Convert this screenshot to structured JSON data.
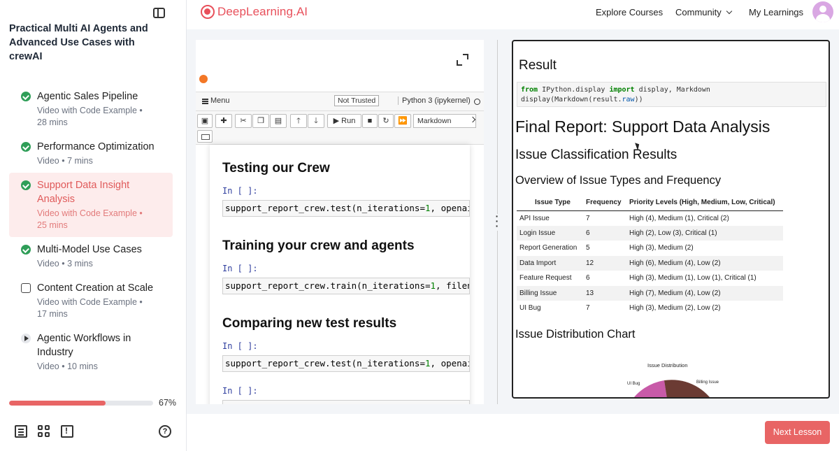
{
  "sidebar": {
    "course_title": "Practical Multi AI Agents and Advanced Use Cases with crewAI",
    "lessons": [
      {
        "title": "Agentic Sales Pipeline",
        "meta1": "Video with Code Example •",
        "meta2": "28 mins",
        "status": "done"
      },
      {
        "title": "Performance Optimization",
        "meta1": "Video • 7 mins",
        "meta2": "",
        "status": "done"
      },
      {
        "title": "Support Data Insight Analysis",
        "meta1": "Video with Code Example •",
        "meta2": "25 mins",
        "status": "done-active"
      },
      {
        "title": "Multi-Model Use Cases",
        "meta1": "Video • 3 mins",
        "meta2": "",
        "status": "done"
      },
      {
        "title": "Content Creation at Scale",
        "meta1": "Video with Code Example •",
        "meta2": "17 mins",
        "status": "pending"
      },
      {
        "title": "Agentic Workflows in Industry",
        "meta1": "Video • 10 mins",
        "meta2": "",
        "status": "play"
      }
    ],
    "progress_pct": 67,
    "progress_label": "67%",
    "footer_icons": [
      "document-icon",
      "grid-icon",
      "feedback-icon",
      "help-icon"
    ]
  },
  "nav": {
    "logo_text": "DeepLearning.AI",
    "explore": "Explore Courses",
    "community": "Community",
    "my_learnings": "My Learnings",
    "brand_color": "#e8505b"
  },
  "notebook": {
    "menu_label": "Menu",
    "trust_label": "Not Trusted",
    "kernel_label": "Python 3 (ipykernel)",
    "run_label": "Run",
    "cell_type": "Markdown",
    "cells": [
      {
        "heading": "Testing our Crew",
        "prompt": "In [ ]:",
        "code_fn": "support_report_crew.test(n_iterations=",
        "code_num": "1",
        "code_rest": ", openai"
      },
      {
        "heading": "Training your crew and agents",
        "prompt": "In [ ]:",
        "code_fn": "support_report_crew.train(n_iterations=",
        "code_num": "1",
        "code_rest": ", filena"
      },
      {
        "heading": "Comparing new test results",
        "prompt": "In [ ]:",
        "code_fn": "support_report_crew.test(n_iterations=",
        "code_num": "1",
        "code_rest": ", openai"
      },
      {
        "heading": "",
        "prompt": "In [ ]:",
        "code_fn": "",
        "code_num": "",
        "code_rest": ""
      }
    ]
  },
  "result": {
    "title": "Result",
    "code_from": "from",
    "code_module": " IPython.display ",
    "code_import": "import",
    "code_names": " display, Markdown",
    "code_line2a": "display(Markdown(result.",
    "code_line2b": "raw",
    "code_line2c": "))",
    "h1": "Final Report: Support Data Analysis",
    "h2": "Issue Classification Results",
    "h3": "Overview of Issue Types and Frequency",
    "table": {
      "headers": [
        "Issue Type",
        "Frequency",
        "Priority Levels (High, Medium, Low, Critical)"
      ],
      "rows": [
        [
          "API Issue",
          "7",
          "High (4), Medium (1), Critical (2)"
        ],
        [
          "Login Issue",
          "6",
          "High (2), Low (3), Critical (1)"
        ],
        [
          "Report Generation",
          "5",
          "High (3), Medium (2)"
        ],
        [
          "Data Import",
          "12",
          "High (6), Medium (4), Low (2)"
        ],
        [
          "Feature Request",
          "6",
          "High (3), Medium (1), Low (1), Critical (1)"
        ],
        [
          "Billing Issue",
          "13",
          "High (7), Medium (4), Low (2)"
        ],
        [
          "UI Bug",
          "7",
          "High (3), Medium (2), Low (2)"
        ]
      ]
    },
    "chart_heading": "Issue Distribution Chart",
    "chart_data": {
      "type": "pie",
      "title": "Issue Distribution",
      "categories": [
        "UI Bug",
        "Billing Issue"
      ],
      "visible_labels": [
        "UI Bug",
        "Billing Issue"
      ],
      "colors": [
        "#c85aa8",
        "#6b3b33"
      ]
    }
  },
  "footer": {
    "next_label": "Next Lesson"
  }
}
